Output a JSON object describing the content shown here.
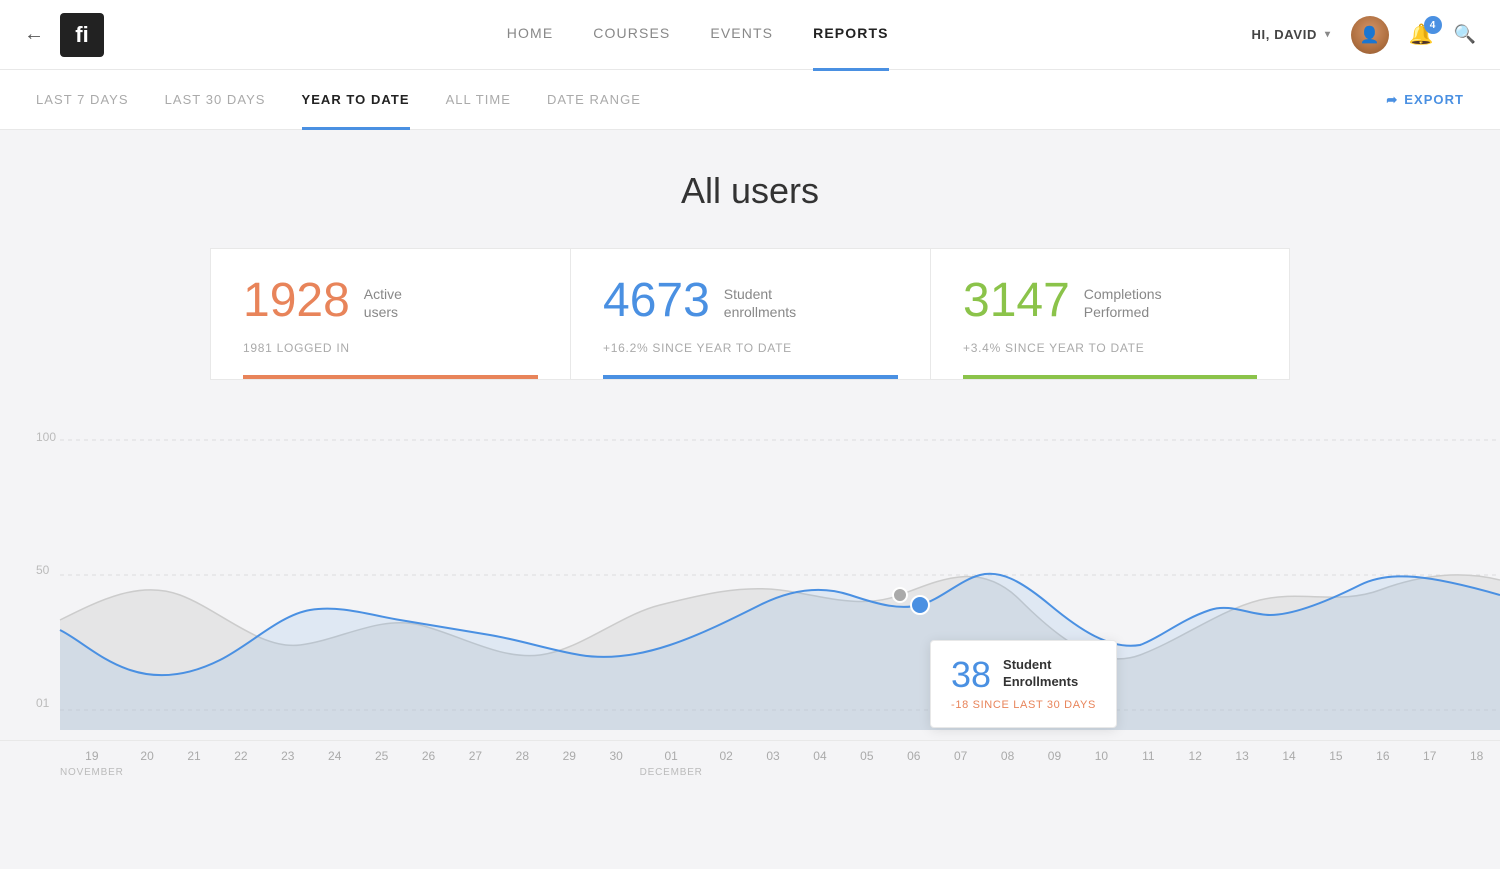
{
  "header": {
    "back_label": "←",
    "logo_text": "fi",
    "nav_items": [
      {
        "label": "HOME",
        "active": false
      },
      {
        "label": "COURSES",
        "active": false
      },
      {
        "label": "EVENTS",
        "active": false
      },
      {
        "label": "REPORTS",
        "active": true
      }
    ],
    "user_label": "HI, DAVID",
    "notification_count": "4",
    "search_icon": "🔍"
  },
  "subnav": {
    "items": [
      {
        "label": "LAST 7 DAYS",
        "active": false
      },
      {
        "label": "LAST 30 DAYS",
        "active": false
      },
      {
        "label": "YEAR TO DATE",
        "active": true
      },
      {
        "label": "ALL TIME",
        "active": false
      },
      {
        "label": "DATE RANGE",
        "active": false
      }
    ],
    "export_label": "EXPORT"
  },
  "main": {
    "page_title": "All users",
    "stats": [
      {
        "number": "1928",
        "label": "Active\nusers",
        "sub": "1981 LOGGED IN",
        "color": "orange",
        "id": "active-users"
      },
      {
        "number": "4673",
        "label": "Student\nenrollments",
        "sub": "+16.2% SINCE YEAR TO DATE",
        "color": "blue",
        "id": "student-enrollments"
      },
      {
        "number": "3147",
        "label": "Completions\nPerformed",
        "sub": "+3.4% SINCE YEAR TO DATE",
        "color": "green",
        "id": "completions"
      }
    ],
    "chart": {
      "y_labels": [
        "100",
        "50",
        "01"
      ],
      "x_labels": [
        {
          "val": "19",
          "month": "NOVEMBER"
        },
        {
          "val": "20",
          "month": ""
        },
        {
          "val": "21",
          "month": ""
        },
        {
          "val": "22",
          "month": ""
        },
        {
          "val": "23",
          "month": ""
        },
        {
          "val": "24",
          "month": ""
        },
        {
          "val": "25",
          "month": ""
        },
        {
          "val": "26",
          "month": ""
        },
        {
          "val": "27",
          "month": ""
        },
        {
          "val": "28",
          "month": ""
        },
        {
          "val": "29",
          "month": ""
        },
        {
          "val": "30",
          "month": ""
        },
        {
          "val": "01",
          "month": "DECEMBER"
        },
        {
          "val": "02",
          "month": ""
        },
        {
          "val": "03",
          "month": ""
        },
        {
          "val": "04",
          "month": ""
        },
        {
          "val": "05",
          "month": ""
        },
        {
          "val": "06",
          "month": ""
        },
        {
          "val": "07",
          "month": ""
        },
        {
          "val": "08",
          "month": ""
        },
        {
          "val": "09",
          "month": ""
        },
        {
          "val": "10",
          "month": ""
        },
        {
          "val": "11",
          "month": ""
        },
        {
          "val": "12",
          "month": ""
        },
        {
          "val": "13",
          "month": ""
        },
        {
          "val": "14",
          "month": ""
        },
        {
          "val": "15",
          "month": ""
        },
        {
          "val": "16",
          "month": ""
        },
        {
          "val": "17",
          "month": ""
        },
        {
          "val": "18",
          "month": ""
        }
      ]
    },
    "tooltip": {
      "number": "38",
      "label": "Student\nEnrollments",
      "sub": "-18 SINCE LAST 30 DAYS"
    }
  }
}
